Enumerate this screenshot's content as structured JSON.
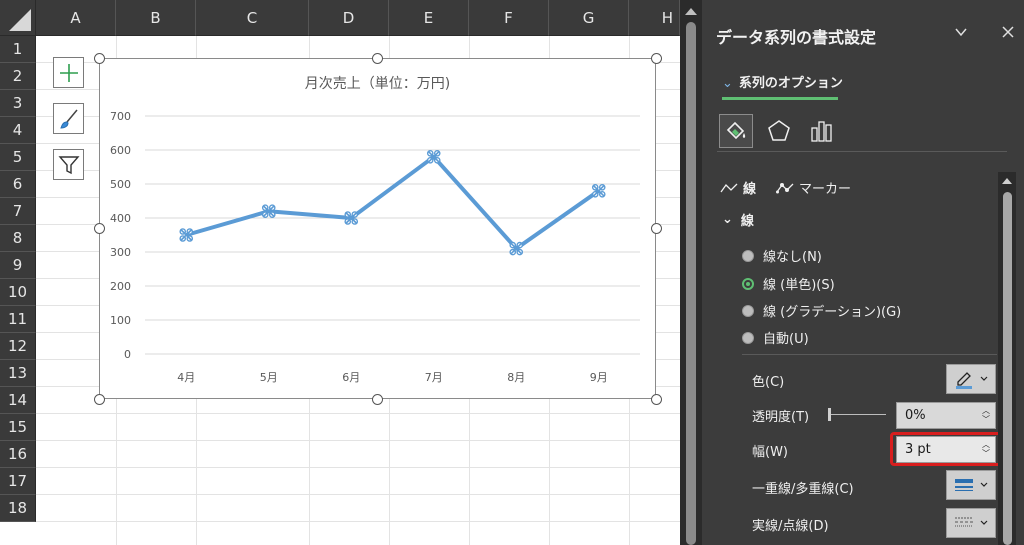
{
  "sheet": {
    "columns": [
      "A",
      "B",
      "C",
      "D",
      "E",
      "F",
      "G",
      "H"
    ],
    "rows": [
      "1",
      "2",
      "3",
      "4",
      "5",
      "6",
      "7",
      "8",
      "9",
      "10",
      "11",
      "12",
      "13",
      "14",
      "15",
      "16",
      "17",
      "18"
    ]
  },
  "chart": {
    "title": "月次売上（単位：万円)"
  },
  "chart_data": {
    "type": "line",
    "title": "月次売上（単位：万円)",
    "categories": [
      "4月",
      "5月",
      "6月",
      "7月",
      "8月",
      "9月"
    ],
    "values": [
      350,
      420,
      400,
      580,
      310,
      480
    ],
    "ylim": [
      0,
      700
    ],
    "yticks": [
      "0",
      "100",
      "200",
      "300",
      "400",
      "500",
      "600",
      "700"
    ],
    "grid": true,
    "line_color": "#5b9bd5",
    "marker": "x-circle"
  },
  "pane": {
    "title": "データ系列の書式設定",
    "tab_series": "系列のオプション",
    "subtab_line": "線",
    "subtab_marker": "マーカー",
    "section_line": "線",
    "radio_none": "線なし(N)",
    "radio_solid": "線 (単色)(S)",
    "radio_gradient": "線 (グラデーション)(G)",
    "radio_auto": "自動(U)",
    "label_color": "色(C)",
    "label_transparency": "透明度(T)",
    "transparency_value": "0%",
    "label_width": "幅(W)",
    "width_value": "3 pt",
    "label_compound": "一重線/多重線(C)",
    "label_dash": "実線/点線(D)"
  },
  "colors": {
    "accent_green": "#5fbf73",
    "highlight_red": "#d81e1e",
    "series_blue": "#5b9bd5"
  }
}
